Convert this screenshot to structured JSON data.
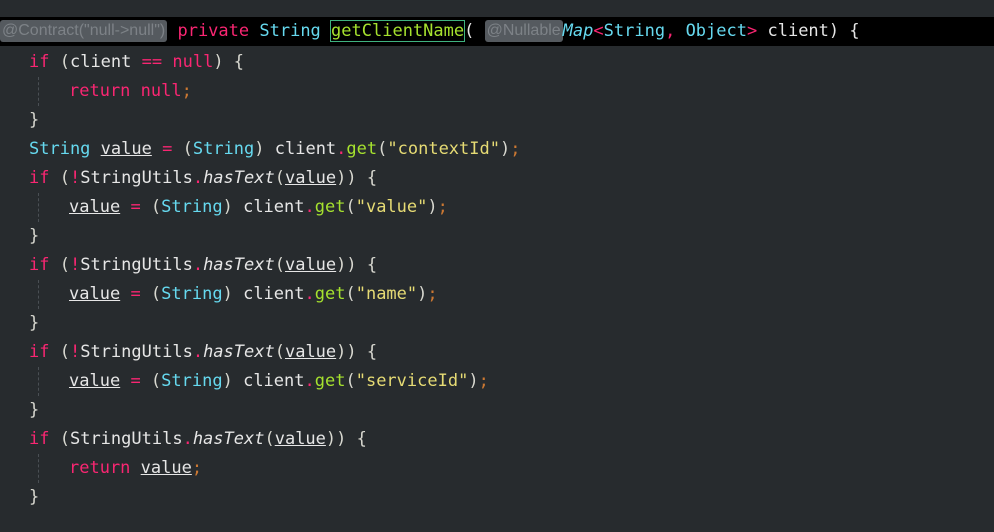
{
  "inlay_hints": {
    "contract": "@Contract(\"null->null\")",
    "nullable": "@Nullable"
  },
  "tokens": {
    "private": "private",
    "String": "String",
    "method": "getClientName",
    "open_paren": "(",
    "Map": "Map",
    "lt": "<",
    "comma": ",",
    "Object": "Object",
    "gt": ">",
    "client": "client",
    "close_brace_open": ") {",
    "if": "if",
    "null": "null",
    "eq": "==",
    "return": "return",
    "semicolon": ";",
    "value": "value",
    "assign": "=",
    "StringUtils": "StringUtils",
    "hasText": "hasText",
    "get": "get",
    "not": "!",
    "dot": ".",
    "rbrace": "}"
  },
  "strings": {
    "contextId": "\"contextId\"",
    "value": "\"value\"",
    "name": "\"name\"",
    "serviceId": "\"serviceId\""
  }
}
